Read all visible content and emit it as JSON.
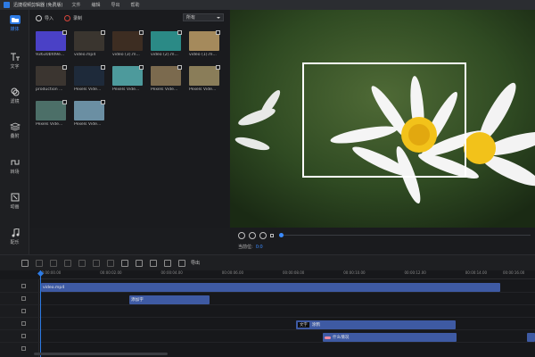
{
  "titlebar": {
    "app_title": "迅捷视频剪辑器 (免费版)",
    "menus": [
      "文件",
      "编辑",
      "导出",
      "帮助"
    ]
  },
  "sidebar": {
    "items": [
      {
        "label": "媒体",
        "icon": "media-icon"
      },
      {
        "label": "文字",
        "icon": "text-icon"
      },
      {
        "label": "滤镜",
        "icon": "filter-icon"
      },
      {
        "label": "叠附",
        "icon": "layers-icon"
      },
      {
        "label": "转场",
        "icon": "transition-icon"
      },
      {
        "label": "动画",
        "icon": "animation-icon"
      },
      {
        "label": "配乐",
        "icon": "music-icon"
      }
    ]
  },
  "media": {
    "import_label": "导入",
    "record_label": "录制",
    "filter_select": "所有",
    "items": [
      {
        "name": "93630bfd9e...",
        "color": "#4a41c6"
      },
      {
        "name": "video.mp4",
        "color": "#3a352f"
      },
      {
        "name": "video (3).m...",
        "color": "#3d2d22"
      },
      {
        "name": "video (2).m...",
        "color": "#2b8a86"
      },
      {
        "name": "video (1).m...",
        "color": "#a58a5c"
      },
      {
        "name": "production ...",
        "color": "#3b3530"
      },
      {
        "name": "Pexels Vide...",
        "color": "#1e2a3a"
      },
      {
        "name": "Pexels Vide...",
        "color": "#4d9a9c"
      },
      {
        "name": "Pexels Vide...",
        "color": "#7b6a4e"
      },
      {
        "name": "Pexels Vide...",
        "color": "#8a7d59"
      },
      {
        "name": "Pexels Vide...",
        "color": "#4c6f68"
      },
      {
        "name": "Pexels Vide...",
        "color": "#6b8fa3"
      }
    ]
  },
  "preview": {
    "time_label": "当前位:",
    "time_value": "0:0"
  },
  "toolbar": {
    "export_label": "导出"
  },
  "timeline": {
    "ruler_ticks": [
      "00:00:00.00",
      "00:00:02.00",
      "00:00:04.00",
      "00:00:06.00",
      "00:00:08.00",
      "00:00:10.00",
      "00:00:12.00",
      "00:00:14.00",
      "00:00:16.00"
    ],
    "clips": {
      "video": "video.mp4",
      "text1": "添加字",
      "text2_tag": "文字",
      "text2": "涂鸦",
      "audio": "什么情况"
    }
  },
  "colors": {
    "accent": "#2d7be5",
    "clip": "#3e5aa3"
  }
}
